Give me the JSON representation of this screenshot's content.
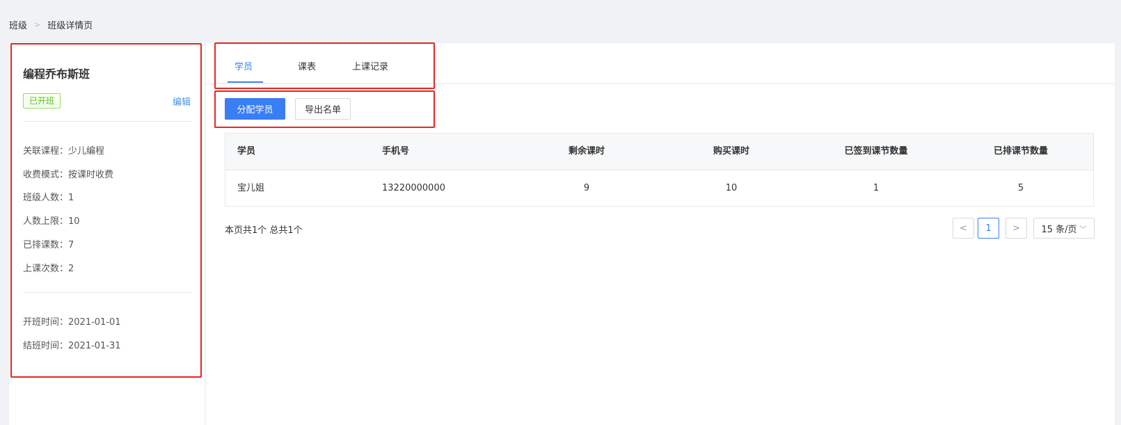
{
  "breadcrumb": {
    "items": [
      "班级",
      "班级详情页"
    ],
    "separator": ">"
  },
  "class_info": {
    "title": "编程乔布斯班",
    "status": "已开班",
    "edit_label": "编辑",
    "details": [
      "关联课程：少儿编程",
      "收费模式：按课时收费",
      "班级人数：1",
      "人数上限：10",
      "已排课数：7",
      "上课次数：2"
    ],
    "dates": [
      "开班时间：2021-01-01",
      "结班时间：2021-01-31"
    ]
  },
  "tabs": [
    {
      "label": "学员",
      "active": true
    },
    {
      "label": "课表",
      "active": false
    },
    {
      "label": "上课记录",
      "active": false
    }
  ],
  "actions": {
    "assign_label": "分配学员",
    "export_label": "导出名单"
  },
  "table": {
    "columns": [
      "学员",
      "手机号",
      "剩余课时",
      "购买课时",
      "已签到课节数量",
      "已排课节数量"
    ],
    "rows": [
      [
        "宝儿姐",
        "13220000000",
        "9",
        "10",
        "1",
        "5"
      ]
    ]
  },
  "pagination": {
    "summary": "本页共1个 总共1个",
    "prev": "<",
    "current": "1",
    "next": ">",
    "page_size": "15 条/页",
    "page_size_chevron": "﹀"
  },
  "colors": {
    "accent": "#3a7ef6",
    "status_green": "#52c41a",
    "highlight_red": "#e8251e"
  }
}
